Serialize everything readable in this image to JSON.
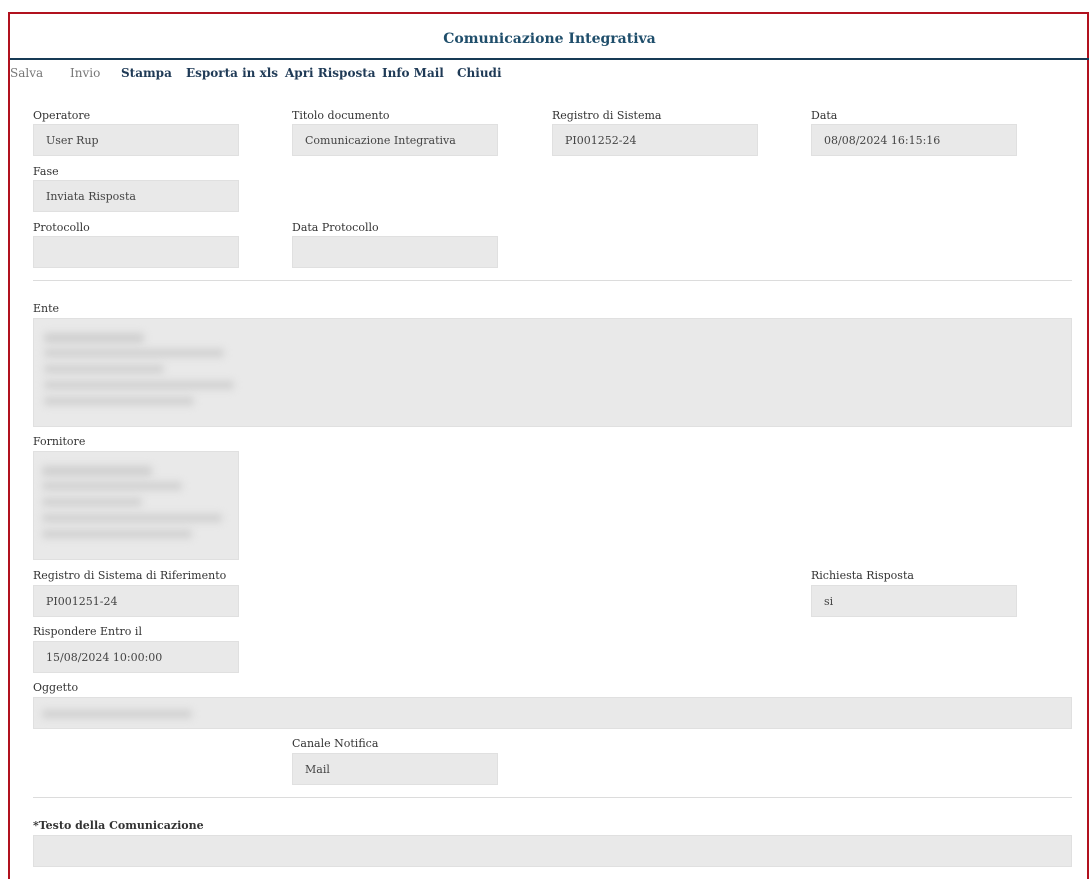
{
  "header": {
    "title": "Comunicazione Integrativa"
  },
  "toolbar": {
    "salva": "Salva",
    "invio": "Invio",
    "stampa": "Stampa",
    "esporta": "Esporta in xls",
    "apri_risposta": "Apri Risposta",
    "info_mail": "Info Mail",
    "chiudi": "Chiudi"
  },
  "form": {
    "operatore": {
      "label": "Operatore",
      "value": "User Rup"
    },
    "titolo_documento": {
      "label": "Titolo documento",
      "value": "Comunicazione Integrativa"
    },
    "registro_sistema": {
      "label": "Registro di Sistema",
      "value": "PI001252-24"
    },
    "data": {
      "label": "Data",
      "value": "08/08/2024 16:15:16"
    },
    "fase": {
      "label": "Fase",
      "value": "Inviata Risposta"
    },
    "protocollo": {
      "label": "Protocollo",
      "value": ""
    },
    "data_protocollo": {
      "label": "Data Protocollo",
      "value": ""
    },
    "ente": {
      "label": "Ente"
    },
    "fornitore": {
      "label": "Fornitore"
    },
    "registro_riferimento": {
      "label": "Registro di Sistema di Riferimento",
      "value": "PI001251-24"
    },
    "richiesta_risposta": {
      "label": "Richiesta Risposta",
      "value": "si"
    },
    "rispondere_entro": {
      "label": "Rispondere Entro il",
      "value": "15/08/2024 10:00:00"
    },
    "oggetto": {
      "label": "Oggetto"
    },
    "canale_notifica": {
      "label": "Canale Notifica",
      "value": "Mail"
    },
    "testo": {
      "label": "*Testo della Comunicazione",
      "value": ""
    }
  }
}
